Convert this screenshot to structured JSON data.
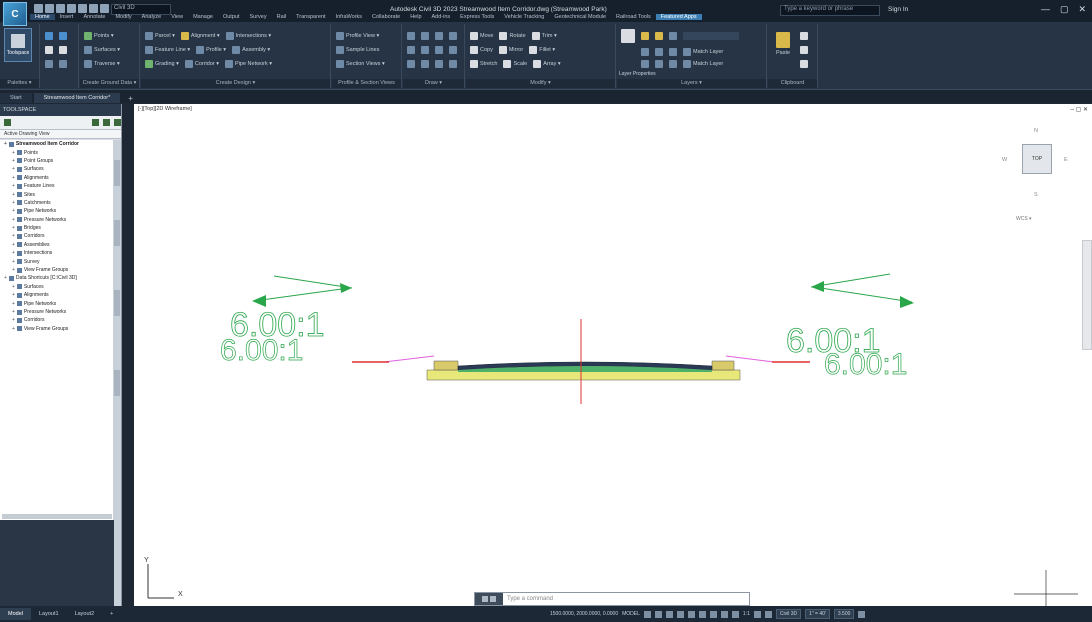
{
  "window": {
    "title": "Autodesk Civil 3D 2023   Streamwood Item Corridor.dwg (Streamwood Park)",
    "workspace": "Civil 3D",
    "search_placeholder": "Type a keyword or phrase",
    "user": "Sign In",
    "controls": [
      "—",
      "▢",
      "✕"
    ]
  },
  "menu_tabs": [
    "Home",
    "Insert",
    "Annotate",
    "Modify",
    "Analyze",
    "View",
    "Manage",
    "Output",
    "Survey",
    "Rail",
    "Transparent",
    "InfraWorks",
    "Collaborate",
    "Help",
    "Add-ins",
    "Express Tools",
    "Vehicle Tracking",
    "Geotechnical Module",
    "Railroad Tools",
    "Featured Apps"
  ],
  "ribbon": {
    "toolspace_button": "Toolspace",
    "panels": [
      {
        "title": "Palettes ▾",
        "items": []
      },
      {
        "title": "Create Ground Data ▾",
        "items": [
          "Points ▾",
          "Surfaces ▾",
          "Traverse ▾"
        ]
      },
      {
        "title": "Create Design ▾",
        "items": [
          "Parcel ▾",
          "Feature Line ▾",
          "Grading ▾",
          "Alignment ▾",
          "Profile ▾",
          "Corridor ▾",
          "Intersections ▾",
          "Assembly ▾",
          "Pipe Network ▾"
        ]
      },
      {
        "title": "Profile & Section Views",
        "items": [
          "Profile View ▾",
          "Sample Lines",
          "Section Views ▾"
        ]
      },
      {
        "title": "Draw ▾",
        "items": []
      },
      {
        "title": "Modify ▾",
        "items": [
          "Move",
          "Rotate",
          "Trim ▾",
          "Copy",
          "Mirror",
          "Fillet ▾",
          "Stretch",
          "Scale",
          "Array ▾"
        ]
      },
      {
        "title": "Layers ▾",
        "items": [
          "Layer Properties",
          "Match Layer",
          "Match Layer"
        ]
      },
      {
        "title": "Clipboard",
        "items": [
          "Paste"
        ]
      }
    ]
  },
  "file_tabs": [
    "Start",
    "Streamwood Item Corridor*"
  ],
  "file_tab_add": "+",
  "toolspace": {
    "title": "TOOLSPACE",
    "tab": "Active Drawing View",
    "tree": [
      {
        "label": "Streamwood Item Corridor",
        "bold": true,
        "indent": 0
      },
      {
        "label": "Points",
        "indent": 1
      },
      {
        "label": "Point Groups",
        "indent": 1
      },
      {
        "label": "Surfaces",
        "indent": 1
      },
      {
        "label": "Alignments",
        "indent": 1
      },
      {
        "label": "Feature Lines",
        "indent": 1
      },
      {
        "label": "Sites",
        "indent": 1
      },
      {
        "label": "Catchments",
        "indent": 1
      },
      {
        "label": "Pipe Networks",
        "indent": 1
      },
      {
        "label": "Pressure Networks",
        "indent": 1
      },
      {
        "label": "Bridges",
        "indent": 1
      },
      {
        "label": "Corridors",
        "indent": 1
      },
      {
        "label": "Assemblies",
        "indent": 1
      },
      {
        "label": "Intersections",
        "indent": 1
      },
      {
        "label": "Survey",
        "indent": 1
      },
      {
        "label": "View Frame Groups",
        "indent": 1
      },
      {
        "label": "Data Shortcuts [C:\\Civil 3D]",
        "indent": 0
      },
      {
        "label": "Surfaces",
        "indent": 1
      },
      {
        "label": "Alignments",
        "indent": 1
      },
      {
        "label": "Pipe Networks",
        "indent": 1
      },
      {
        "label": "Pressure Networks",
        "indent": 1
      },
      {
        "label": "Corridors",
        "indent": 1
      },
      {
        "label": "View Frame Groups",
        "indent": 1
      }
    ]
  },
  "viewport": {
    "label": "[-][Top][2D Wireframe]",
    "controls": "– ▢ ✕",
    "viewcube": {
      "face": "TOP",
      "n": "N",
      "s": "S",
      "e": "E",
      "w": "W",
      "wcs": "WCS ▾"
    },
    "annotations": {
      "left_slope": "6.00:1",
      "right_slope": "6.00:1"
    },
    "ucs": {
      "x": "X",
      "y": "Y"
    }
  },
  "command_line": {
    "placeholder": "Type a command"
  },
  "status_bar": {
    "layout_tabs": [
      "Model",
      "Layout1",
      "Layout2"
    ],
    "layout_add": "+",
    "coords": "1500.0000, 2000.0000, 0.0000",
    "mode": "MODEL",
    "scale": "1:1",
    "workspace_box": "Civil 3D",
    "zoom_box": "1\" = 40'",
    "units": "3.500"
  },
  "colors": {
    "title_bg": "#15202c",
    "ribbon_bg": "#263445",
    "canvas_bg": "#ffffff",
    "pavement": "#e8e87a",
    "pavement_top": "#2a3a55",
    "slope_text": "#2aa64a",
    "centerline": "#e23030",
    "daylight": "#e060e0"
  }
}
